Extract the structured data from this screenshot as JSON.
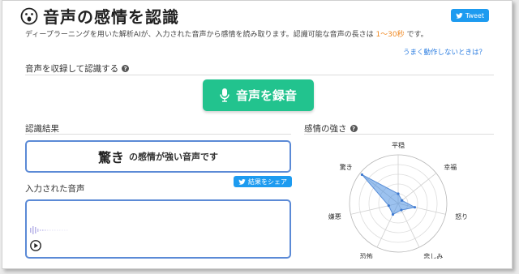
{
  "header": {
    "title": "音声の感情を認識",
    "tweet_label": "Tweet"
  },
  "description": {
    "text": "ディープラーニングを用いた解析AIが、入力された音声から感情を読み取ります。認識可能な音声の長さは ",
    "range": "1〜30秒",
    "suffix": " です。"
  },
  "help_link": "うまく動作しないときは？",
  "record_section": {
    "heading": "音声を収録して認識する",
    "button_label": "音声を録音"
  },
  "result_section": {
    "heading": "認識結果",
    "emotion": "驚き",
    "suffix": "の感情が強い音声です",
    "share_label": "結果をシェア"
  },
  "input_section": {
    "heading": "入力された音声"
  },
  "emotion_section": {
    "heading": "感情の強さ"
  },
  "chart_data": {
    "type": "radar",
    "categories": [
      "平穏",
      "幸福",
      "怒り",
      "悲しみ",
      "恐怖",
      "嫌悪",
      "驚き"
    ],
    "values": [
      0.2,
      0.1,
      0.35,
      0.15,
      0.25,
      0.2,
      0.95
    ],
    "max": 1.0,
    "rings": 5,
    "fill_color": "#4a90e2"
  },
  "colors": {
    "accent_orange": "#f08a24",
    "link_blue": "#2b7de1",
    "record_green": "#22c38e",
    "twitter_blue": "#1d9bf0",
    "box_border": "#5b8ad6"
  }
}
